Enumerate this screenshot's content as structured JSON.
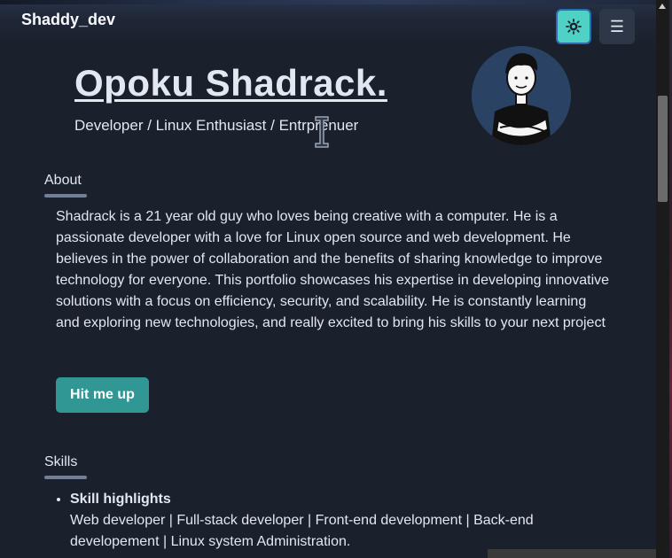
{
  "nav": {
    "brand": "Shaddy_dev",
    "theme_icon": "sun-icon",
    "menu_icon": "hamburger-menu-icon",
    "menu_glyph": "☰"
  },
  "hero": {
    "title": "Opoku Shadrack.",
    "subtitle": "Developer / Linux Enthusiast / Entrprenuer"
  },
  "about": {
    "heading": "About",
    "text": "Shadrack is a 21 year old guy who loves being creative with a computer. He is a passionate developer with a love for Linux open source and web development. He believes in the power of collaboration and the benefits of sharing knowledge to improve technology for everyone. This portfolio showcases his expertise in developing innovative solutions with a focus on efficiency, security, and scalability. He is constantly learning and exploring new technologies, and really excited to bring his skills to your next project",
    "cta": "Hit me up"
  },
  "skills": {
    "heading": "Skills",
    "items": [
      {
        "title": "Skill highlights",
        "text": "Web developer | Full-stack developer | Front-end development | Back-end developement | Linux system Administration."
      }
    ]
  },
  "colors": {
    "background": "#1a202c",
    "accent": "#4fd1c5",
    "button": "#319795"
  }
}
